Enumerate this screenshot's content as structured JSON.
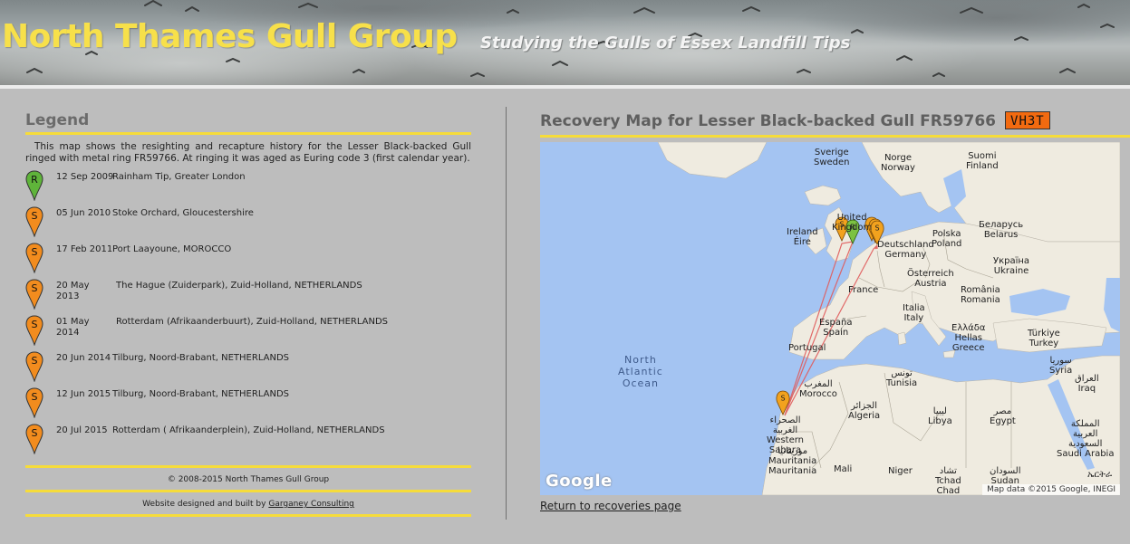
{
  "header": {
    "title": "North Thames Gull Group",
    "subtitle": "Studying the Gulls of Essex Landfill Tips"
  },
  "legend": {
    "heading": "Legend",
    "intro": "This map shows the resighting and recapture history for the Lesser Black-backed Gull ringed with metal ring FR59766. At ringing it was aged as Euring code 3 (first calendar year).",
    "events": [
      {
        "type": "R",
        "color": "#5fb43a",
        "date": "12 Sep 2009",
        "place": "Rainham Tip, Greater London"
      },
      {
        "type": "S",
        "color": "#f28c1e",
        "date": "05 Jun 2010",
        "place": "Stoke Orchard, Gloucestershire"
      },
      {
        "type": "S",
        "color": "#f28c1e",
        "date": "17 Feb 2011",
        "place": "Port Laayoune, MOROCCO"
      },
      {
        "type": "S",
        "color": "#f28c1e",
        "date": "20 May 2013",
        "place": "The Hague (Zuiderpark), Zuid-Holland, NETHERLANDS"
      },
      {
        "type": "S",
        "color": "#f28c1e",
        "date": "01 May 2014",
        "place": "Rotterdam (Afrikaanderbuurt), Zuid-Holland, NETHERLANDS"
      },
      {
        "type": "S",
        "color": "#f28c1e",
        "date": "20 Jun 2014",
        "place": "Tilburg, Noord-Brabant, NETHERLANDS"
      },
      {
        "type": "S",
        "color": "#f28c1e",
        "date": "12 Jun 2015",
        "place": "Tilburg, Noord-Brabant, NETHERLANDS"
      },
      {
        "type": "S",
        "color": "#f28c1e",
        "date": "20 Jul 2015",
        "place": "Rotterdam ( Afrikaanderplein), Zuid-Holland, NETHERLANDS"
      }
    ]
  },
  "footer": {
    "copyright": "© 2008-2015 North Thames Gull Group",
    "credit_prefix": "Website designed and built by ",
    "credit_link": "Garganey Consulting"
  },
  "recovery": {
    "heading": "Recovery Map for Lesser Black-backed Gull FR59766",
    "ring_code": "VH3T",
    "return_link": "Return to recoveries page"
  },
  "map": {
    "labels": {
      "sverige": "Sverige\nSweden",
      "suomi": "Suomi\nFinland",
      "norge": "Norge\nNorway",
      "uk": "United\nKingdom",
      "ireland": "Ireland\nÉire",
      "deutschland": "Deutschland\nGermany",
      "polska": "Polska\nPoland",
      "belarus": "Беларусь\nBelarus",
      "ukraine": "Україна\nUkraine",
      "osterreich": "Österreich\nAustria",
      "france": "France",
      "romania": "România\nRomania",
      "italia": "Italia\nItaly",
      "espana": "España\nSpain",
      "portugal": "Portugal",
      "hellas": "Ελλάδα\nHellas\nGreece",
      "turkiye": "Türkiye\nTurkey",
      "ocean": "North\nAtlantic\nOcean",
      "tunisia": "تونس\nTunisia",
      "syria": "سوريا\nSyria",
      "iraq": "العراق\nIraq",
      "morocco": "المغرب\nMorocco",
      "algeria": "الجزائر\nAlgeria",
      "libya": "ليبيا\nLibya",
      "egypt": "مصر\nEgypt",
      "saudi": "المملكة\nالعربية\nالسعودية\nSaudi Arabia",
      "western_sahara": "الصحراء\nالغربية\nWestern\nSahara",
      "mauritania": "موريتانيا\nMauritania\nMauritania",
      "mali": "Mali",
      "niger": "Niger",
      "chad": "تشاد\nTchad\nChad",
      "sudan": "السودان\nSudan",
      "eritrea": "ኤርትራ"
    },
    "google_logo": "Google",
    "attribution": "Map data ©2015 Google, INEGI",
    "markers": [
      {
        "type": "R",
        "color": "#7cc242"
      },
      {
        "type": "S",
        "color": "#f2a21e"
      }
    ]
  },
  "colors": {
    "accent_yellow": "#f6dc3a",
    "ring_badge": "#f26a10",
    "route_line": "#e05c5c",
    "sea": "#a4c4f2",
    "land": "#efebe0"
  }
}
